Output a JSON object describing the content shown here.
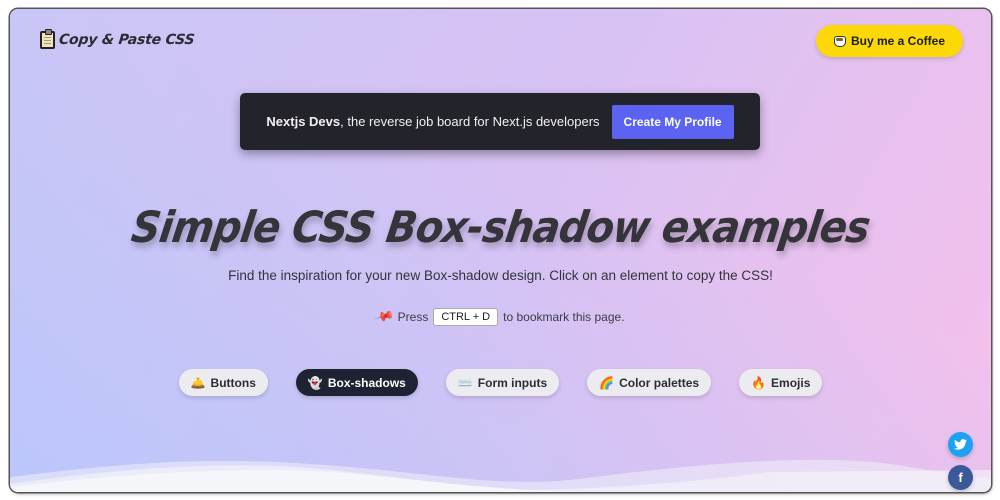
{
  "header": {
    "logo_text": "Copy & Paste CSS",
    "logo_icon": "clipboard-icon",
    "coffee_button": {
      "label": "Buy me a Coffee",
      "icon": "coffee-cup-icon",
      "color": "#fcd808"
    }
  },
  "banner": {
    "brand": "Nextjs Devs",
    "text": ", the reverse job board for Next.js developers",
    "button_label": "Create My Profile",
    "button_color": "#5b63f0"
  },
  "hero": {
    "title": "Simple CSS Box-shadow examples",
    "subtitle": "Find the inspiration for your new Box-shadow design. Click on an element to copy the CSS!",
    "bookmark": {
      "icon": "pushpin-icon",
      "prefix": "Press",
      "shortcut": "CTRL + D",
      "suffix": "to bookmark this page."
    }
  },
  "nav": {
    "items": [
      {
        "label": "Buttons",
        "icon": "bell-icon",
        "glyph": "🛎️",
        "active": false
      },
      {
        "label": "Box-shadows",
        "icon": "ghost-icon",
        "glyph": "👻",
        "active": true
      },
      {
        "label": "Form inputs",
        "icon": "keyboard-icon",
        "glyph": "⌨️",
        "active": false
      },
      {
        "label": "Color palettes",
        "icon": "rainbow-icon",
        "glyph": "🌈",
        "active": false
      },
      {
        "label": "Emojis",
        "icon": "fire-icon",
        "glyph": "🔥",
        "active": false
      }
    ]
  },
  "social": {
    "twitter": {
      "icon": "twitter-icon",
      "color": "#1da1f2"
    },
    "facebook": {
      "icon": "facebook-icon",
      "glyph": "f",
      "color": "#3b5998"
    }
  }
}
